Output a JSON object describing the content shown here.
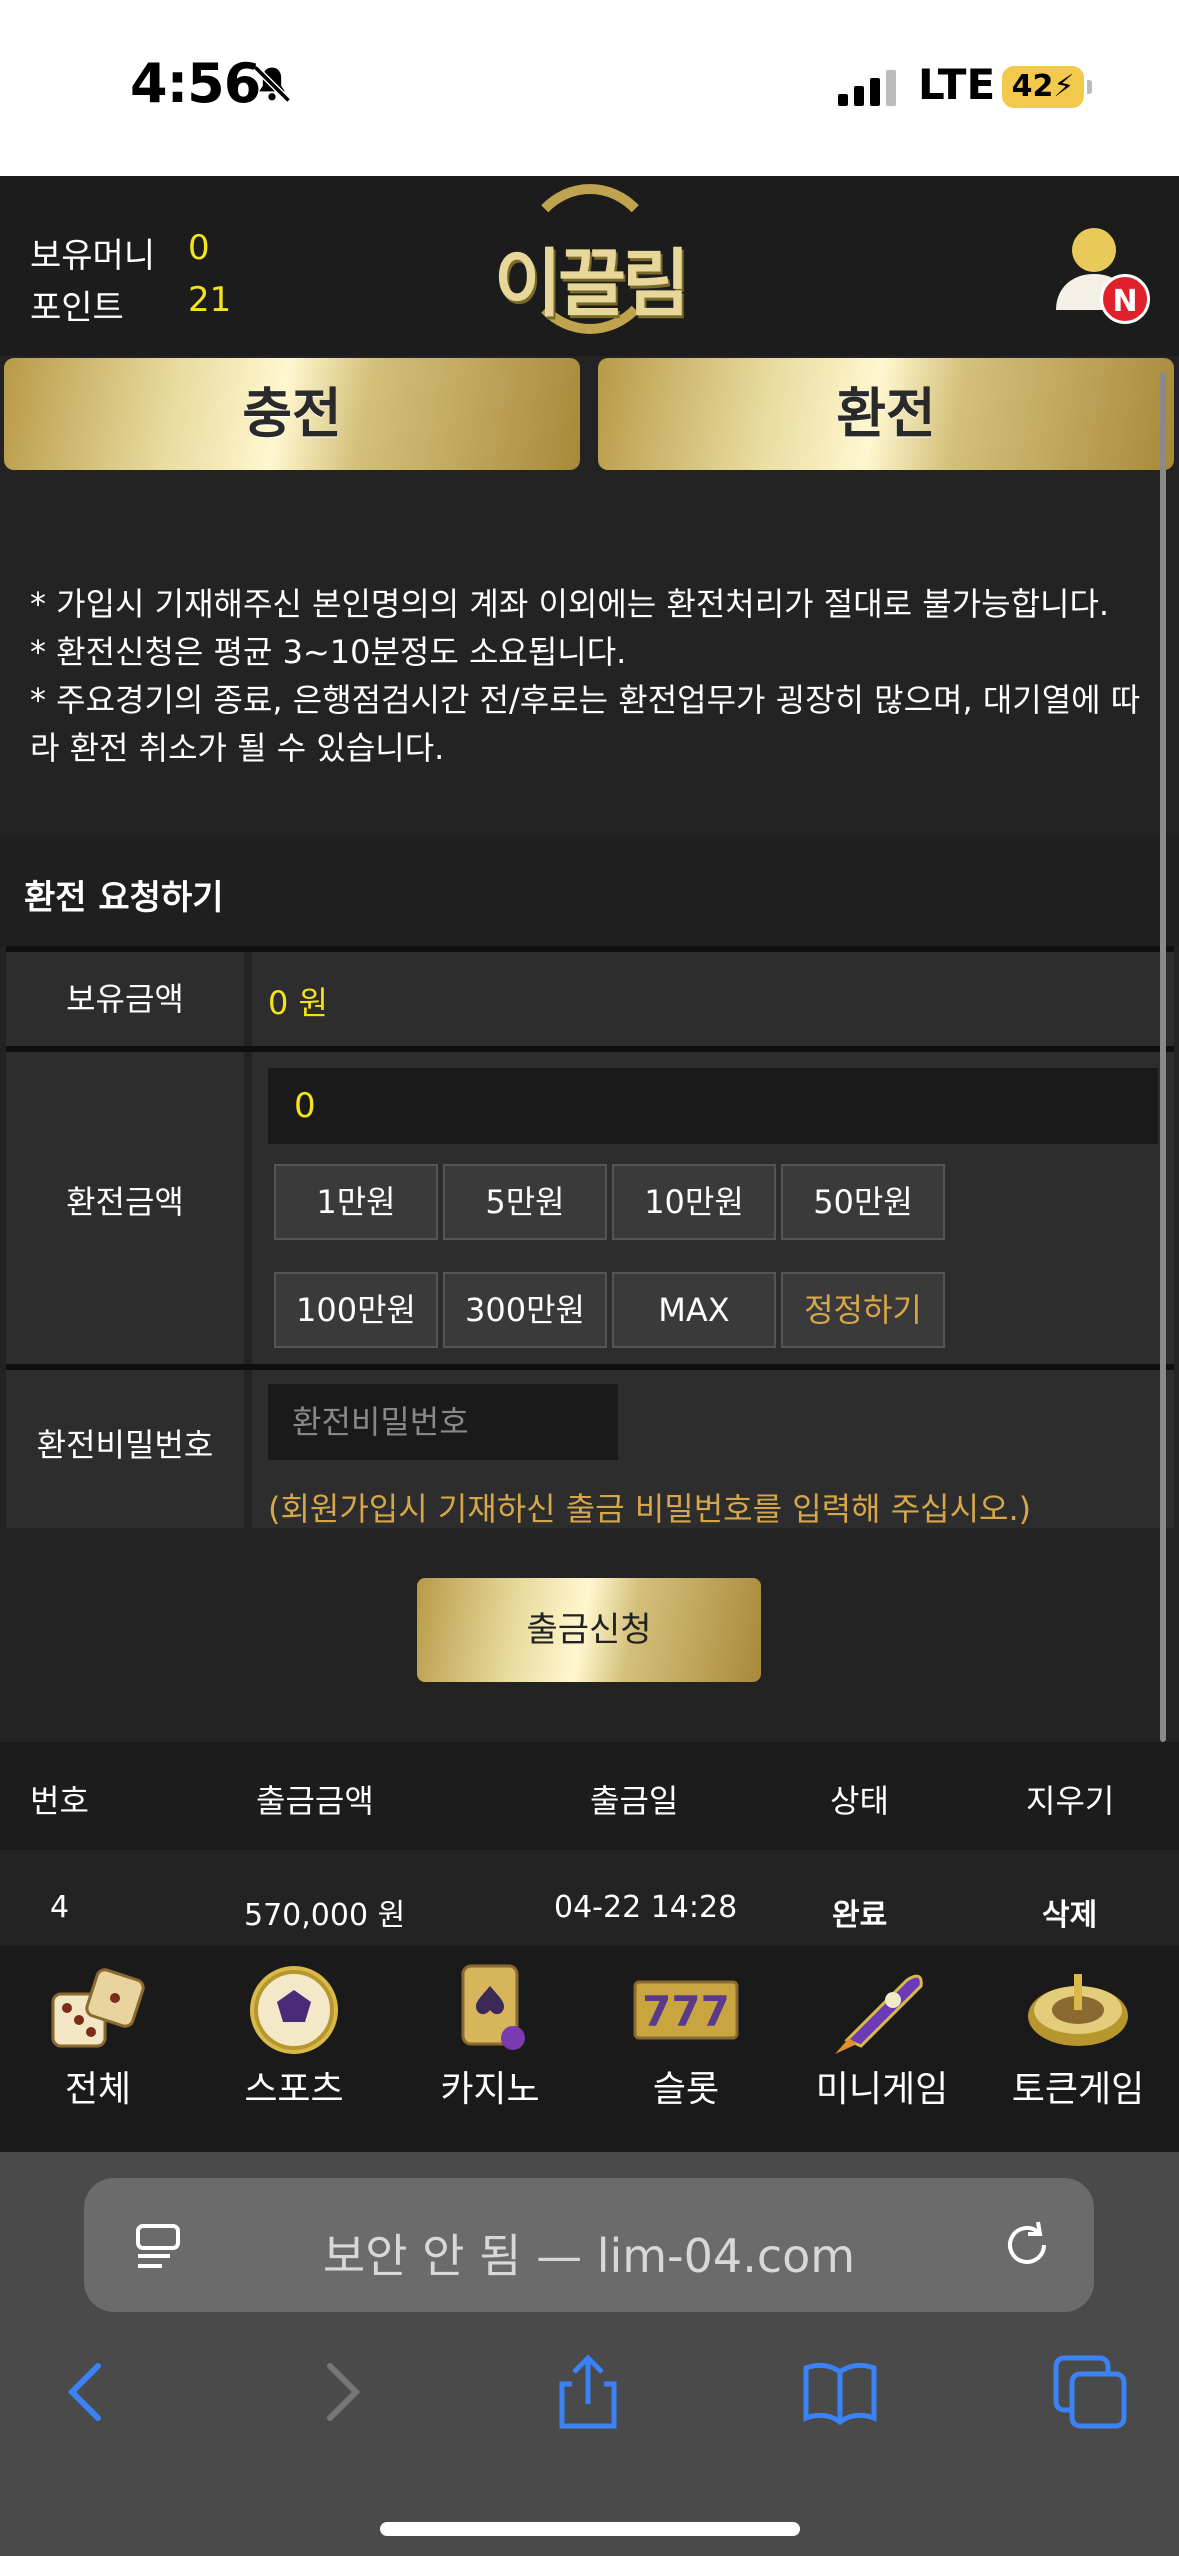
{
  "status_bar": {
    "time": "4:56",
    "network": "LTE",
    "battery": "42"
  },
  "header": {
    "balance_label": "보유머니",
    "balance_value": "0",
    "points_label": "포인트",
    "points_value": "21",
    "logo_text": "이끌림",
    "notification_badge": "N"
  },
  "tabs": {
    "deposit": "충전",
    "withdraw": "환전"
  },
  "notice": {
    "lines": [
      "* 가입시 기재해주신 본인명의의 계좌 이외에는 환전처리가 절대로 불가능합니다.",
      "* 환전신청은 평균 3~10분정도 소요됩니다.",
      "* 주요경기의 종료, 은행점검시간 전/후로는 환전업무가 굉장히 많으며, 대기열에 따라 환전 취소가 될 수 있습니다."
    ]
  },
  "form": {
    "section_title": "환전 요청하기",
    "held_label": "보유금액",
    "held_value": "0 원",
    "amount_label": "환전금액",
    "amount_value": "0",
    "amount_buttons": [
      "1만원",
      "5만원",
      "10만원",
      "50만원",
      "100만원",
      "300만원",
      "MAX",
      "정정하기"
    ],
    "password_label": "환전비밀번호",
    "password_placeholder": "환전비밀번호",
    "password_hint": "(회원가입시 기재하신 출금 비밀번호를 입력해 주십시오.)",
    "submit_label": "출금신청"
  },
  "history": {
    "columns": [
      "번호",
      "출금금액",
      "출금일",
      "상태",
      "지우기"
    ],
    "rows": [
      {
        "no": "4",
        "amount": "570,000 원",
        "date": "04-22 14:28",
        "status": "완료",
        "action": "삭제"
      }
    ]
  },
  "game_nav": [
    {
      "label": "전체",
      "icon": "dice-icon"
    },
    {
      "label": "스포츠",
      "icon": "soccer-ball-icon"
    },
    {
      "label": "카지노",
      "icon": "playing-card-icon"
    },
    {
      "label": "슬롯",
      "icon": "slot-777-icon"
    },
    {
      "label": "미니게임",
      "icon": "rocket-icon"
    },
    {
      "label": "토큰게임",
      "icon": "roulette-icon"
    }
  ],
  "browser": {
    "url_text": "보안 안 됨 — lim-04.com"
  },
  "colors": {
    "accent_gold": "#e9dca0",
    "value_yellow": "#f5e31b",
    "hint_orange": "#d6a64a",
    "badge_red": "#e0202a"
  }
}
